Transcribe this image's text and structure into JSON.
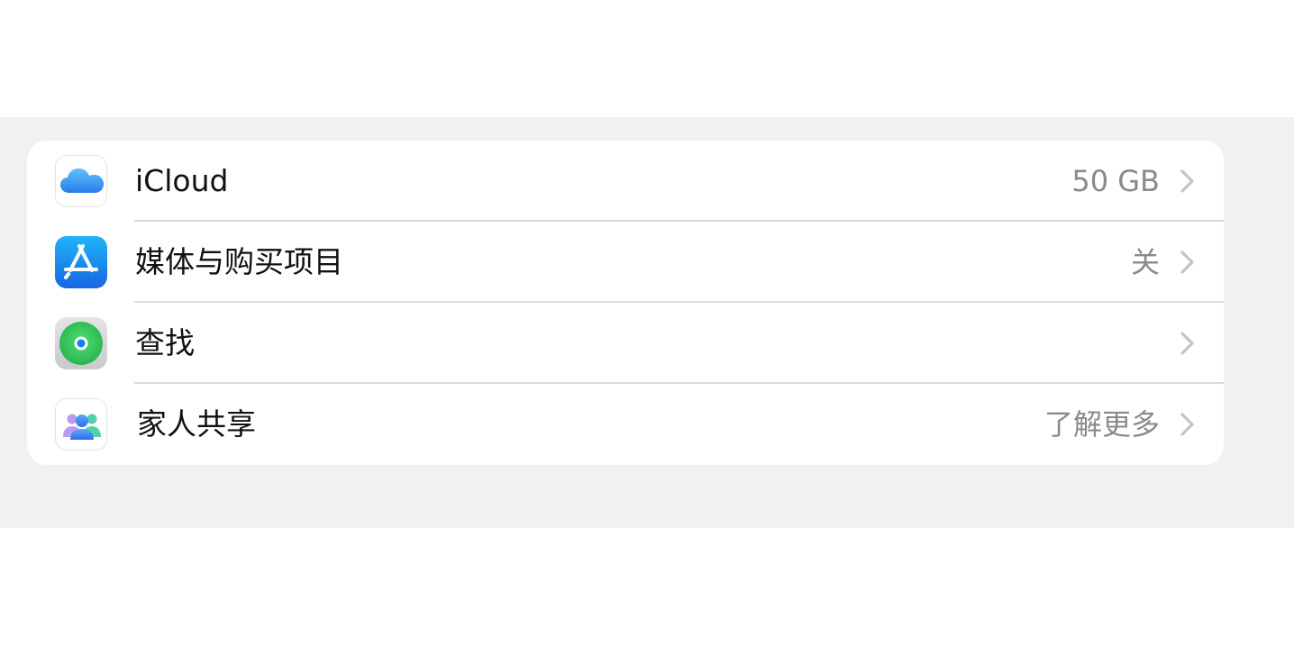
{
  "settings": {
    "items": [
      {
        "id": "icloud",
        "icon": "icloud-icon",
        "label": "iCloud",
        "value": "50 GB"
      },
      {
        "id": "media-purchases",
        "icon": "app-store-icon",
        "label": "媒体与购买项目",
        "value": "关"
      },
      {
        "id": "find-my",
        "icon": "find-my-icon",
        "label": "查找",
        "value": ""
      },
      {
        "id": "family-sharing",
        "icon": "family-sharing-icon",
        "label": "家人共享",
        "value": "了解更多"
      }
    ]
  },
  "colors": {
    "grouped_background": "#f1f1f4",
    "card_background": "#ffffff",
    "separator": "#dadadd",
    "secondary_text": "#8a8a8e",
    "chevron": "#c4c4c7",
    "app_store_blue": "#1a84f5",
    "find_my_green": "#34c759"
  }
}
